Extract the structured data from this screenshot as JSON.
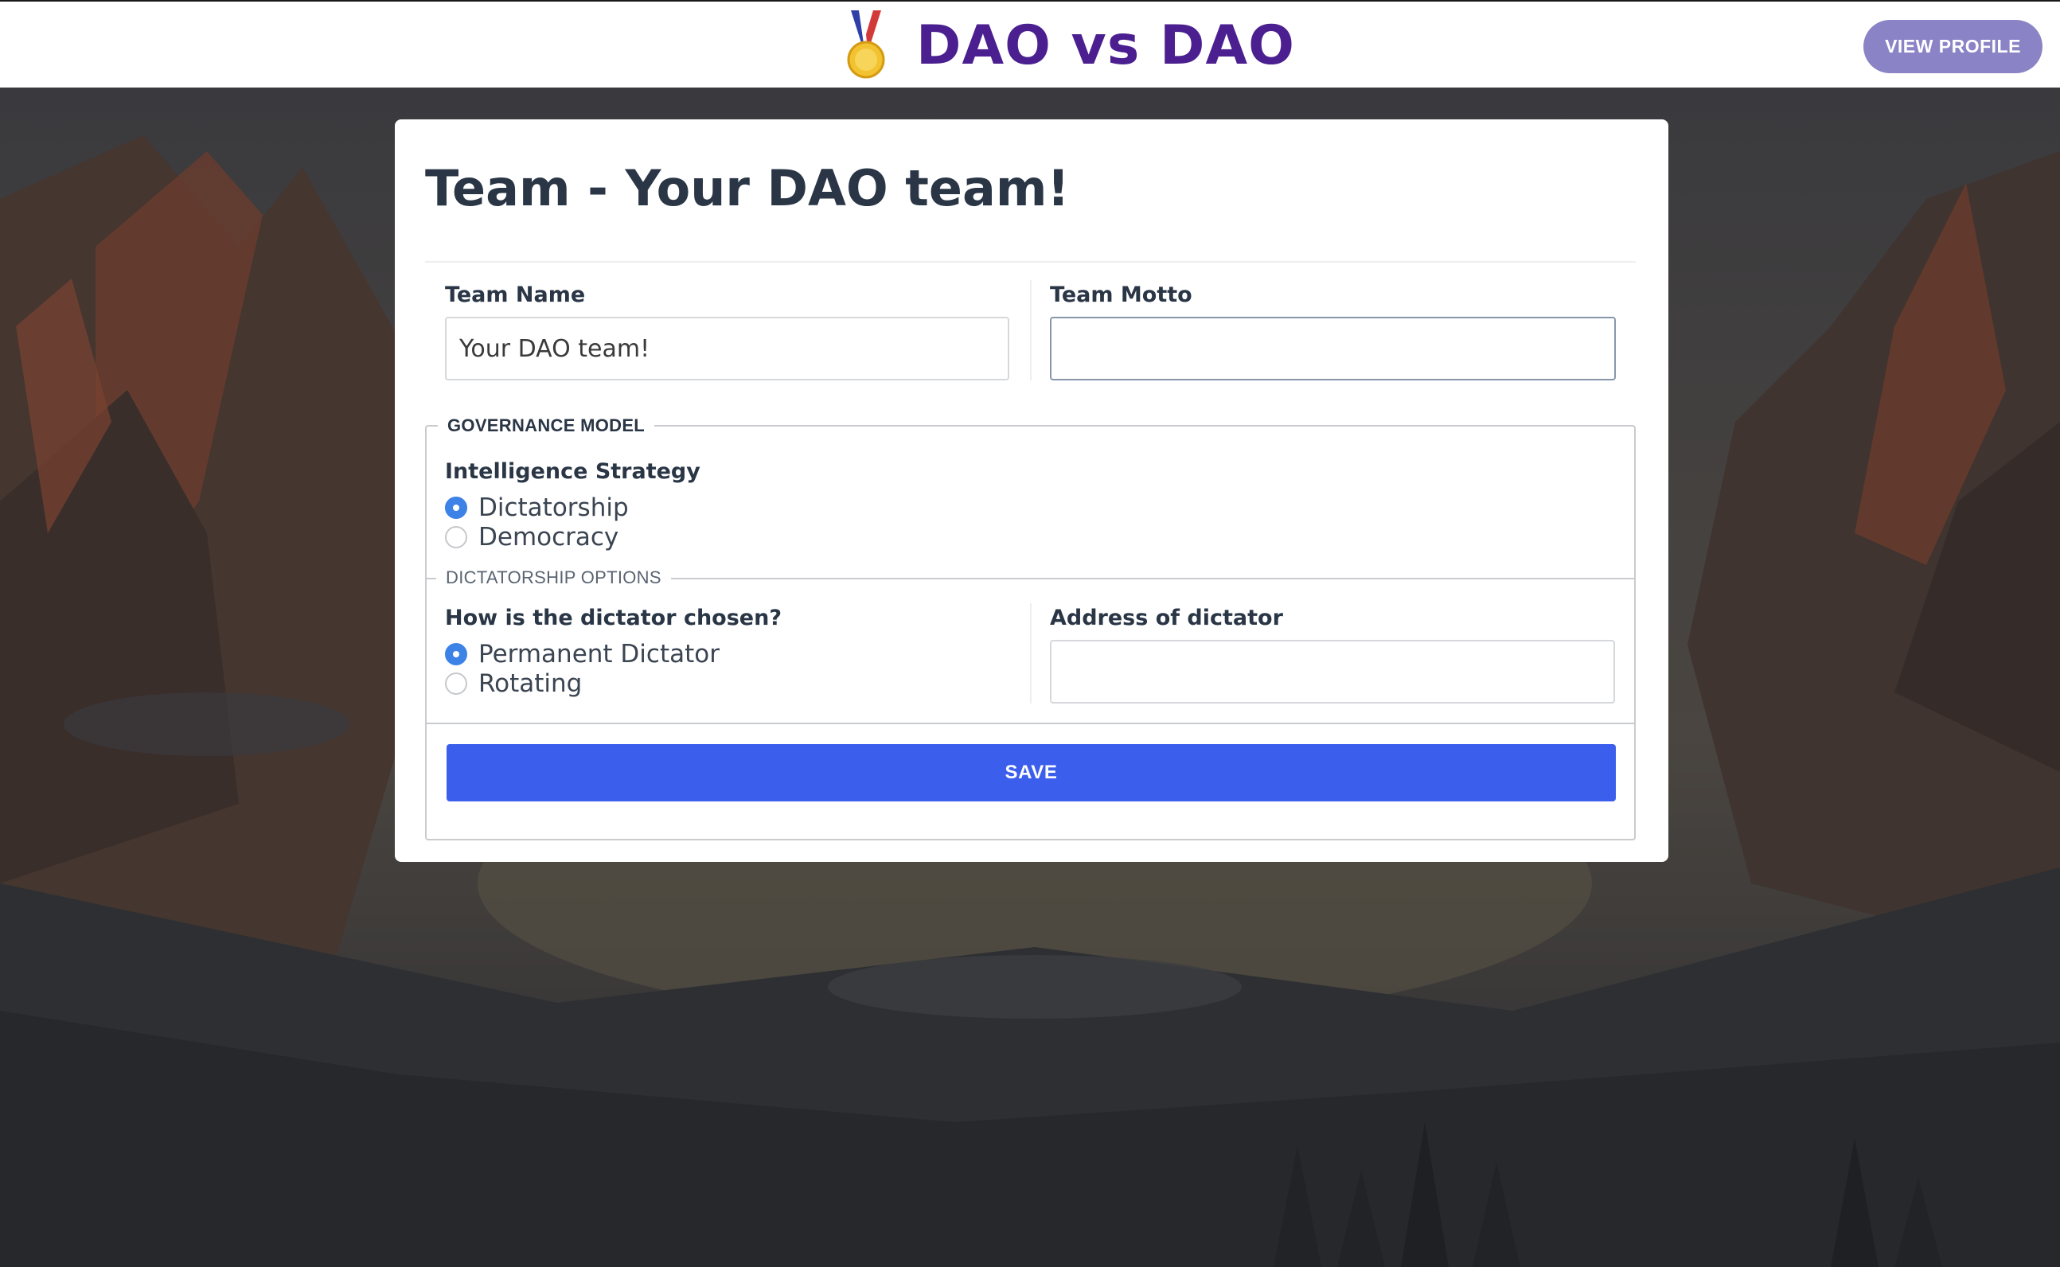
{
  "header": {
    "brand_title": "DAO vs DAO",
    "brand_icon": "medal-icon",
    "view_profile_label": "VIEW PROFILE"
  },
  "form": {
    "title": "Team - Your DAO team!",
    "team_name": {
      "label": "Team Name",
      "value": "Your DAO team!"
    },
    "team_motto": {
      "label": "Team Motto",
      "value": ""
    },
    "governance": {
      "legend": "GOVERNANCE MODEL",
      "strategy_label": "Intelligence Strategy",
      "options": [
        {
          "label": "Dictatorship",
          "checked": true
        },
        {
          "label": "Democracy",
          "checked": false
        }
      ]
    },
    "dictatorship": {
      "legend": "DICTATORSHIP OPTIONS",
      "chosen_label": "How is the dictator chosen?",
      "options": [
        {
          "label": "Permanent Dictator",
          "checked": true
        },
        {
          "label": "Rotating",
          "checked": false
        }
      ],
      "address_label": "Address of dictator",
      "address_value": ""
    },
    "save_label": "SAVE"
  },
  "colors": {
    "brand": "#4b1f8f",
    "view_profile_bg": "#8a84c6",
    "save_bg": "#3c5eec",
    "radio_checked": "#3d82e6"
  }
}
